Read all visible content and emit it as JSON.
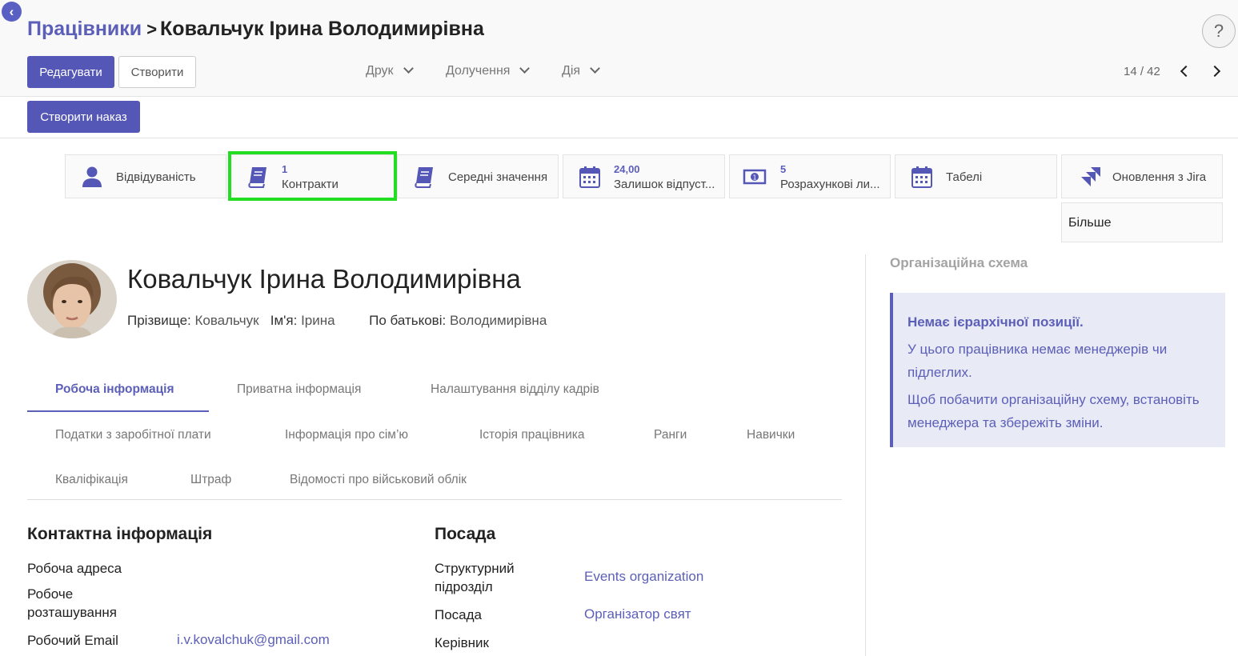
{
  "header": {
    "breadcrumb_parent": "Працівники",
    "breadcrumb_separator": ">",
    "breadcrumb_current": "Ковальчук Ірина Володимирівна",
    "help": "?"
  },
  "toolbar": {
    "edit_label": "Редагувати",
    "create_label": "Створити",
    "print_label": "Друк",
    "attach_label": "Долучення",
    "action_label": "Дія",
    "pager": "14 / 42",
    "create_order_label": "Створити наказ"
  },
  "smart_buttons": [
    {
      "label": "Відвідуваність",
      "icon": "user-icon"
    },
    {
      "count": "1",
      "label": "Контракти",
      "icon": "book-icon"
    },
    {
      "label": "Середні значення",
      "icon": "book-icon"
    },
    {
      "count": "24,00",
      "label": "Залишок відпуст...",
      "icon": "calendar-icon"
    },
    {
      "count": "5",
      "label": "Розрахункові ли...",
      "icon": "money-icon"
    },
    {
      "label": "Табелі",
      "icon": "calendar-icon"
    },
    {
      "label": "Оновлення з Jira",
      "icon": "jira-icon"
    }
  ],
  "more_label": "Більше",
  "employee": {
    "full_name": "Ковальчук Ірина Володимирівна",
    "surname_label": "Прізвище:",
    "surname": "Ковальчук",
    "first_name_label": "Ім'я:",
    "first_name": "Ірина",
    "patronymic_label": "По батькові:",
    "patronymic": "Володимирівна"
  },
  "tabs": [
    "Робоча інформація",
    "Приватна інформація",
    "Налаштування відділу кадрів",
    "Податки з заробітної плати",
    "Інформація про сім’ю",
    "Історія працівника",
    "Ранги",
    "Навички",
    "Кваліфікація",
    "Штраф",
    "Відомості про військовий облік"
  ],
  "contact": {
    "title": "Контактна інформація",
    "work_address_label": "Робоча адреса",
    "work_location_label": "Робоче розташування",
    "work_email_label": "Робочий Email",
    "work_email": "i.v.kovalchuk@gmail.com"
  },
  "position": {
    "title": "Посада",
    "department_label": "Структурний підрозділ",
    "department": "Events organization",
    "job_label": "Посада",
    "job": "Організатор свят",
    "manager_label": "Керівник"
  },
  "org_chart": {
    "title": "Організаційна схема",
    "no_position": "Немає ієрархічної позиції.",
    "line1": "У цього працівника немає менеджерів чи підлеглих.",
    "line2": "Щоб побачити організаційну схему, встановіть менеджера та збережіть зміни."
  },
  "colors": {
    "primary": "#5457b5",
    "link": "#5c5fb8",
    "highlight": "#22dd22",
    "info_bg": "#e8eaf5"
  }
}
